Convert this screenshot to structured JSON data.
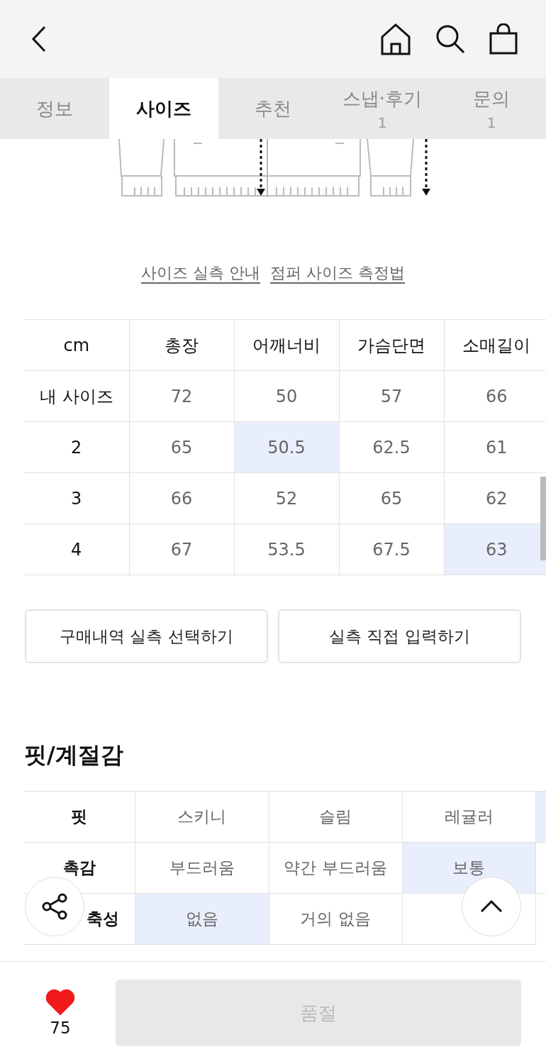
{
  "tabs": [
    {
      "label": "정보",
      "selected": false
    },
    {
      "label": "사이즈",
      "selected": true
    },
    {
      "label": "추천",
      "selected": false
    },
    {
      "label": "스냅·후기",
      "count": "1",
      "selected": false
    },
    {
      "label": "문의",
      "count": "1",
      "selected": false
    }
  ],
  "guide_links": [
    "사이즈 실측 안내",
    "점퍼 사이즈 측정법"
  ],
  "size_table": {
    "corner_label": "cm",
    "columns": [
      "총장",
      "어깨너비",
      "가슴단면",
      "소매길이"
    ],
    "rows": [
      {
        "label": "내 사이즈",
        "cells": [
          {
            "text": "72",
            "selected": false
          },
          {
            "text": "50",
            "selected": false
          },
          {
            "text": "57",
            "selected": false
          },
          {
            "text": "66",
            "selected": false
          }
        ]
      },
      {
        "label": "2",
        "cells": [
          {
            "text": "65",
            "selected": false
          },
          {
            "text": "50.5",
            "selected": true
          },
          {
            "text": "62.5",
            "selected": false
          },
          {
            "text": "61",
            "selected": false
          }
        ]
      },
      {
        "label": "3",
        "cells": [
          {
            "text": "66",
            "selected": false
          },
          {
            "text": "52",
            "selected": false
          },
          {
            "text": "65",
            "selected": false
          },
          {
            "text": "62",
            "selected": false
          }
        ]
      },
      {
        "label": "4",
        "cells": [
          {
            "text": "67",
            "selected": false
          },
          {
            "text": "53.5",
            "selected": false
          },
          {
            "text": "67.5",
            "selected": false
          },
          {
            "text": "63",
            "selected": true
          }
        ]
      }
    ]
  },
  "size_buttons": [
    "구매내역 실측 선택하기",
    "실측 직접 입력하기"
  ],
  "fit_section": {
    "title": "핏/계절감",
    "rows": [
      {
        "label": "핏",
        "options": [
          {
            "label": "스키니",
            "selected": false
          },
          {
            "label": "슬림",
            "selected": false
          },
          {
            "label": "레귤러",
            "selected": false
          },
          {
            "selected": true
          }
        ]
      },
      {
        "label": "촉감",
        "options": [
          {
            "label": "부드러움",
            "selected": false
          },
          {
            "label": "약간 부드러움",
            "selected": false
          },
          {
            "label": "보통",
            "selected": true
          },
          {
            "selected": false
          }
        ]
      },
      {
        "label": "축성",
        "options": [
          {
            "label": "없음",
            "selected": true
          },
          {
            "label": "거의 없음",
            "selected": false
          },
          {
            "selected": false
          }
        ]
      }
    ]
  },
  "bottom_bar": {
    "likes": "75",
    "liked": true,
    "buy_button": {
      "label": "품절",
      "disabled": true
    }
  }
}
